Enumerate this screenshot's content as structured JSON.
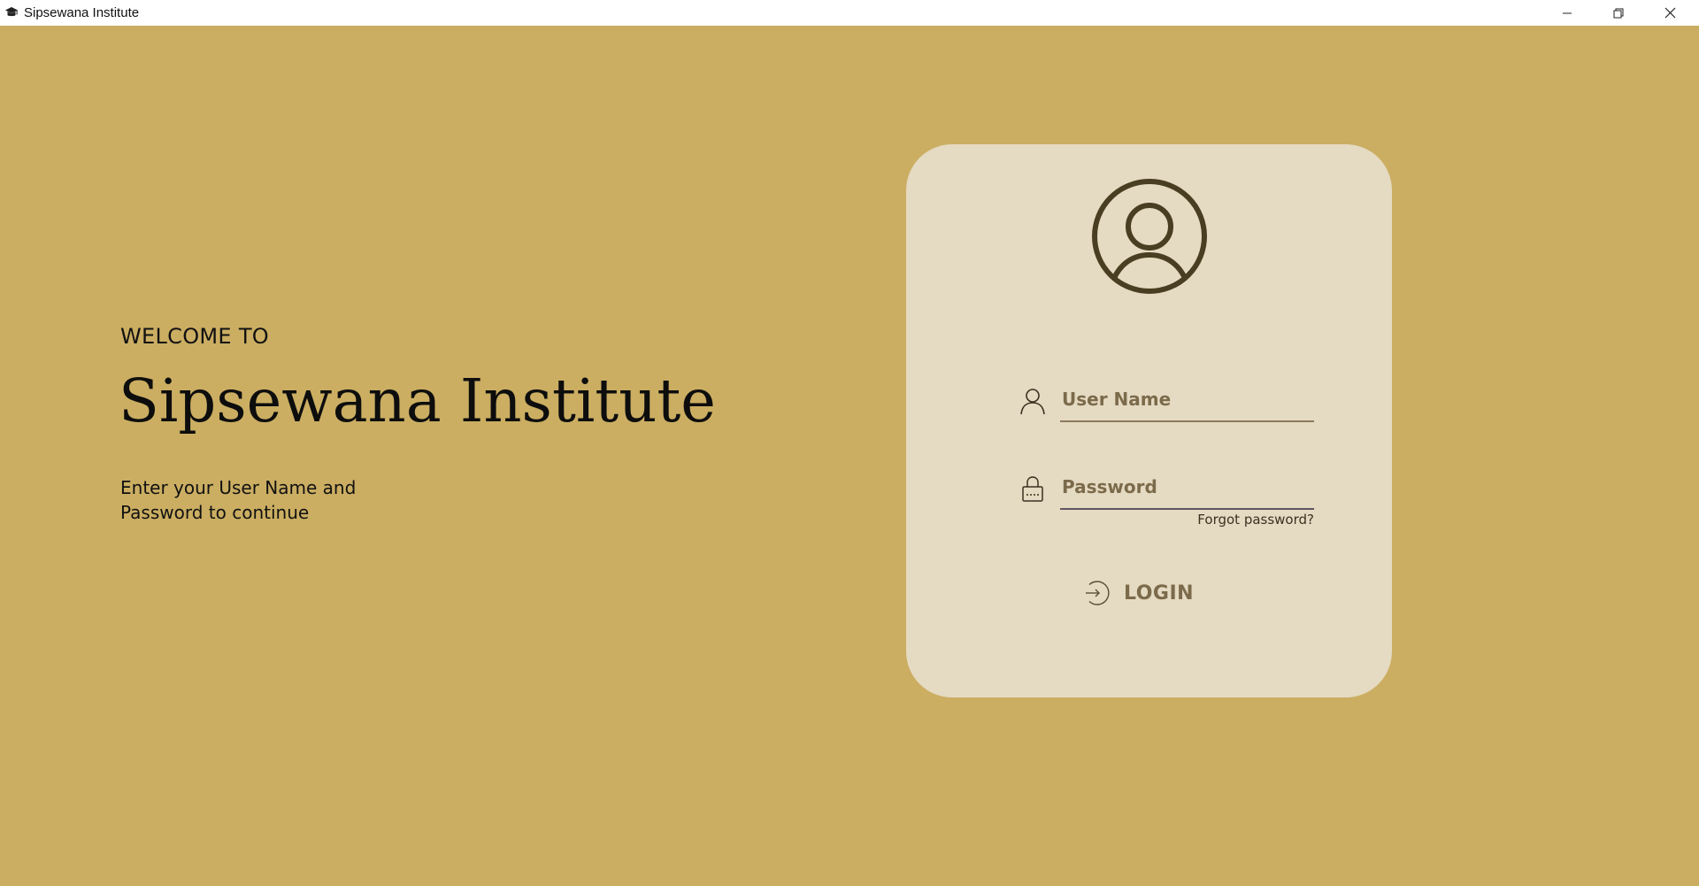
{
  "window": {
    "title": "Sipsewana Institute",
    "controls": {
      "minimize": "minimize",
      "maximize": "restore",
      "close": "close"
    }
  },
  "welcome": {
    "label": "WELCOME TO",
    "brand": "Sipsewana Institute",
    "subtitle": "Enter your User Name and Password to continue"
  },
  "login": {
    "avatar_icon": "user-circle-icon",
    "username": {
      "icon": "user-icon",
      "value": "",
      "placeholder": "User Name"
    },
    "password": {
      "icon": "lock-icon",
      "value": "",
      "placeholder": "Password"
    },
    "forgot_label": "Forgot password?",
    "login_label": "LOGIN",
    "login_icon": "login-arrow-icon"
  },
  "colors": {
    "background": "#CBAE62",
    "card": "#E5DAC2",
    "accent_text": "#7B6B4B",
    "icon_dark": "#4A3E22"
  }
}
